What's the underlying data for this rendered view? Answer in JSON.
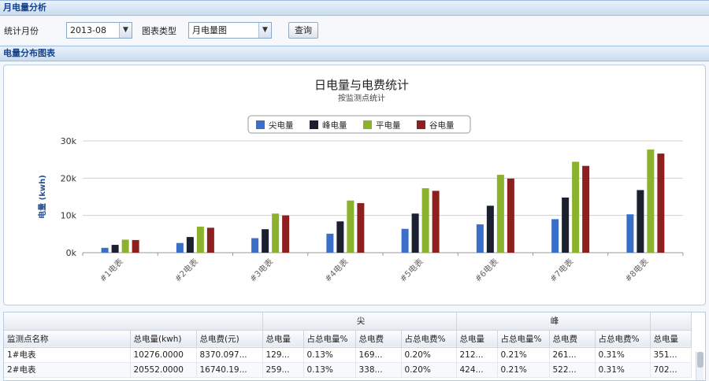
{
  "header1": {
    "title": "月电量分析"
  },
  "toolbar": {
    "month_label": "统计月份",
    "month_value": "2013-08",
    "chart_type_label": "图表类型",
    "chart_type_value": "月电量图",
    "query_button": "查询"
  },
  "header2": {
    "title": "电量分布图表"
  },
  "chart_data": {
    "type": "bar",
    "title": "日电量与电费统计",
    "subtitle": "按监测点统计",
    "ylabel": "电量 (kwh)",
    "xlabel": "",
    "categories": [
      "#1电表",
      "#2电表",
      "#3电表",
      "#4电表",
      "#5电表",
      "#6电表",
      "#7电表",
      "#8电表"
    ],
    "ylim": [
      0,
      30000
    ],
    "yticks": [
      0,
      10000,
      20000,
      30000
    ],
    "ytick_labels": [
      "0k",
      "10k",
      "20k",
      "30k"
    ],
    "legend_position": "top-center",
    "grid": true,
    "series": [
      {
        "name": "尖电量",
        "color": "#3a6fc9",
        "values": [
          1300,
          2600,
          3900,
          5100,
          6400,
          7600,
          9000,
          10300
        ]
      },
      {
        "name": "峰电量",
        "color": "#1a2030",
        "values": [
          2100,
          4200,
          6300,
          8400,
          10500,
          12600,
          14800,
          16800
        ]
      },
      {
        "name": "平电量",
        "color": "#8ab22d",
        "values": [
          3500,
          7000,
          10500,
          14000,
          17300,
          20900,
          24400,
          27700
        ]
      },
      {
        "name": "谷电量",
        "color": "#8e1f1f",
        "values": [
          3400,
          6700,
          10000,
          13300,
          16600,
          19900,
          23300,
          26600
        ]
      }
    ]
  },
  "grid": {
    "group_headers": [
      "尖",
      "峰"
    ],
    "columns": [
      "监测点名称",
      "总电量(kwh)",
      "总电费(元)",
      "总电量",
      "占总电量%",
      "总电费",
      "占总电费%",
      "总电量",
      "占总电量%",
      "总电费",
      "占总电费%",
      "总电量"
    ],
    "rows": [
      [
        "1#电表",
        "10276.0000",
        "8370.097...",
        "129...",
        "0.13%",
        "169...",
        "0.20%",
        "212...",
        "0.21%",
        "261...",
        "0.31%",
        "351..."
      ],
      [
        "2#电表",
        "20552.0000",
        "16740.19...",
        "259...",
        "0.13%",
        "338...",
        "0.20%",
        "424...",
        "0.21%",
        "522...",
        "0.31%",
        "702..."
      ]
    ]
  }
}
